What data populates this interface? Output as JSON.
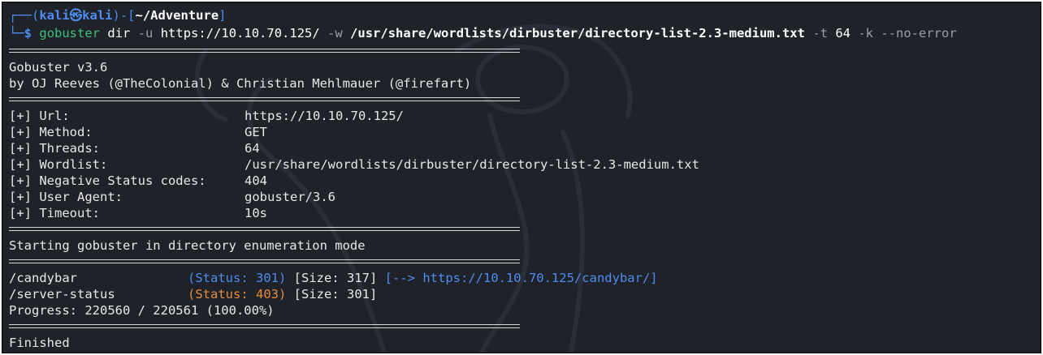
{
  "prompt": {
    "line1_prefix": "┌──(",
    "user": "kali",
    "at_symbol": "㉿",
    "host": "kali",
    "mid": ")-[",
    "cwd": "~/Adventure",
    "end": "]",
    "line2_prefix": "└─",
    "dollar": "$"
  },
  "command": {
    "program": "gobuster",
    "subcommand": "dir",
    "flag_u": "-u",
    "url": "https://10.10.70.125/",
    "flag_w": "-w",
    "wordlist": "/usr/share/wordlists/dirbuster/directory-list-2.3-medium.txt",
    "flag_t": "-t",
    "threads": "64",
    "flag_k": "-k",
    "flag_noerror": "--no-error"
  },
  "banner": {
    "title": "Gobuster v3.6",
    "authors": "by OJ Reeves (@TheColonial) & Christian Mehlmauer (@firefart)"
  },
  "config": [
    {
      "label": "[+] Url:",
      "value": "https://10.10.70.125/"
    },
    {
      "label": "[+] Method:",
      "value": "GET"
    },
    {
      "label": "[+] Threads:",
      "value": "64"
    },
    {
      "label": "[+] Wordlist:",
      "value": "/usr/share/wordlists/dirbuster/directory-list-2.3-medium.txt"
    },
    {
      "label": "[+] Negative Status codes:",
      "value": "404"
    },
    {
      "label": "[+] User Agent:",
      "value": "gobuster/3.6"
    },
    {
      "label": "[+] Timeout:",
      "value": "10s"
    }
  ],
  "starting": "Starting gobuster in directory enumeration mode",
  "results": [
    {
      "path": "/candybar",
      "status": "(Status: 301)",
      "size": "[Size: 317]",
      "redirect": "[--> https://10.10.70.125/candybar/]"
    },
    {
      "path": "/server-status",
      "status": "(Status: 403)",
      "size": "[Size: 301]"
    }
  ],
  "progress": "Progress: 220560 / 220561 (100.00%)",
  "finished": "Finished",
  "colors": {
    "background": "#1f2229",
    "text": "#e8e8e8",
    "prompt_blue": "#4d8df0",
    "prompt_green": "#3ec07a",
    "status_301": "#4d8df0",
    "status_403": "#e88b3a"
  }
}
